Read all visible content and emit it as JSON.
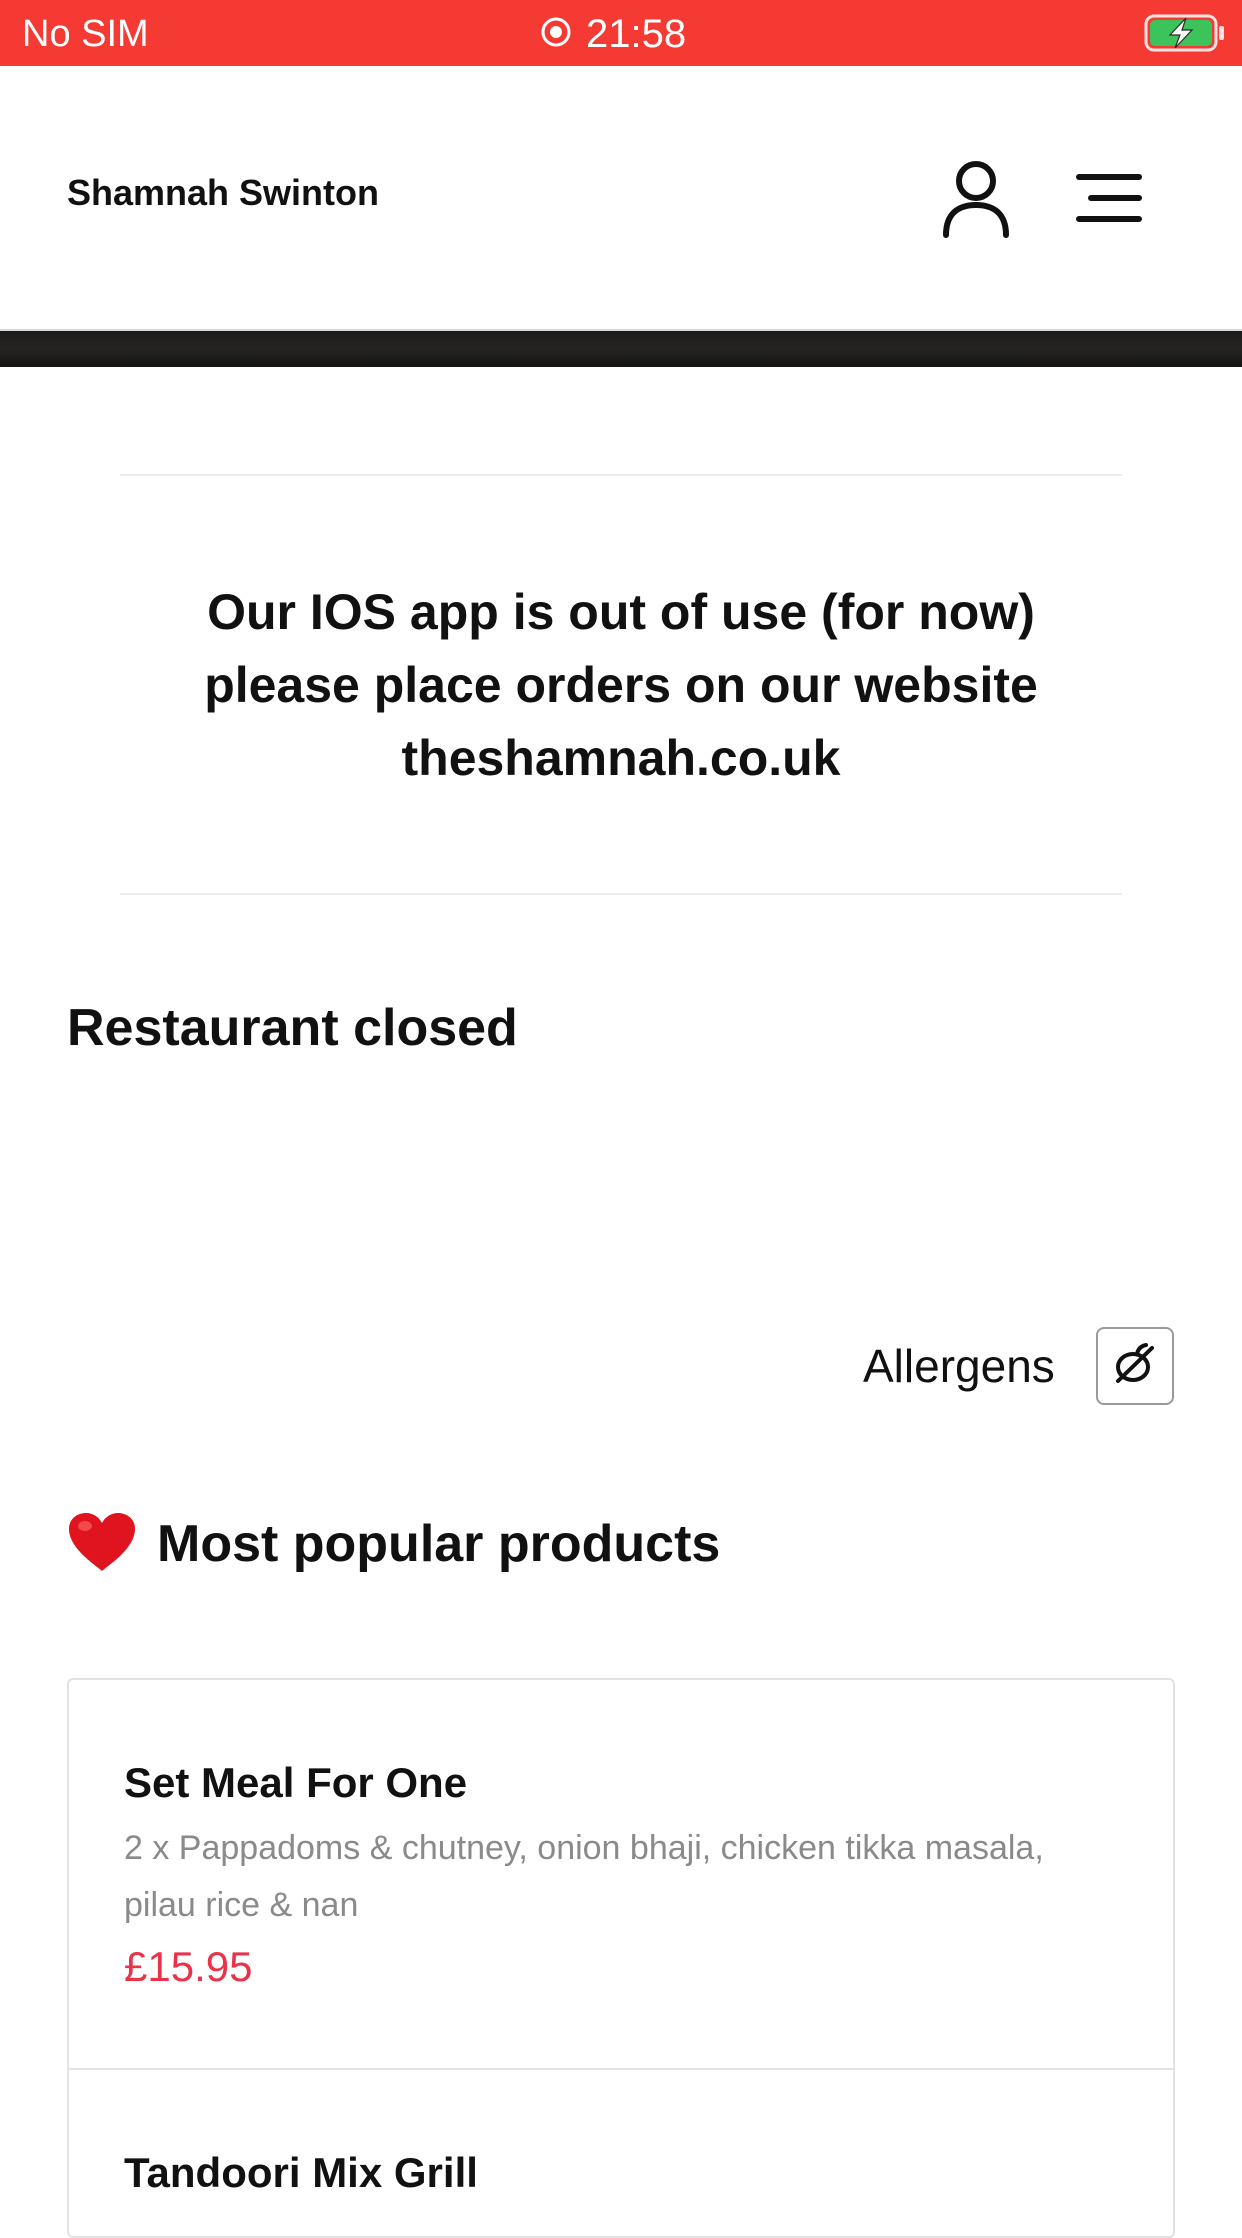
{
  "status_bar": {
    "carrier": "No SIM",
    "time": "21:58",
    "background_color": "#f43a33",
    "battery_charging": true,
    "icons": [
      "location-icon",
      "battery-charging-icon"
    ]
  },
  "header": {
    "brand_name": "Shamnah Swinton",
    "icons": [
      "account-icon",
      "menu-icon"
    ]
  },
  "notice": {
    "text": "Our IOS app is out of use (for now) please place orders on our website theshamnah.co.uk"
  },
  "restaurant_status": "Restaurant closed",
  "allergens": {
    "label": "Allergens",
    "icon": "allergens-icon"
  },
  "popular": {
    "icon": "heart-icon",
    "title": "Most popular products",
    "products": [
      {
        "name": "Set Meal For One",
        "description": "2 x Pappadoms & chutney, onion bhaji, chicken tikka masala, pilau rice & nan",
        "price": "£15.95"
      },
      {
        "name": "Tandoori Mix Grill"
      }
    ]
  },
  "colors": {
    "accent": "#f43a33",
    "price": "#e8334b",
    "muted_text": "#8a8a8a"
  }
}
